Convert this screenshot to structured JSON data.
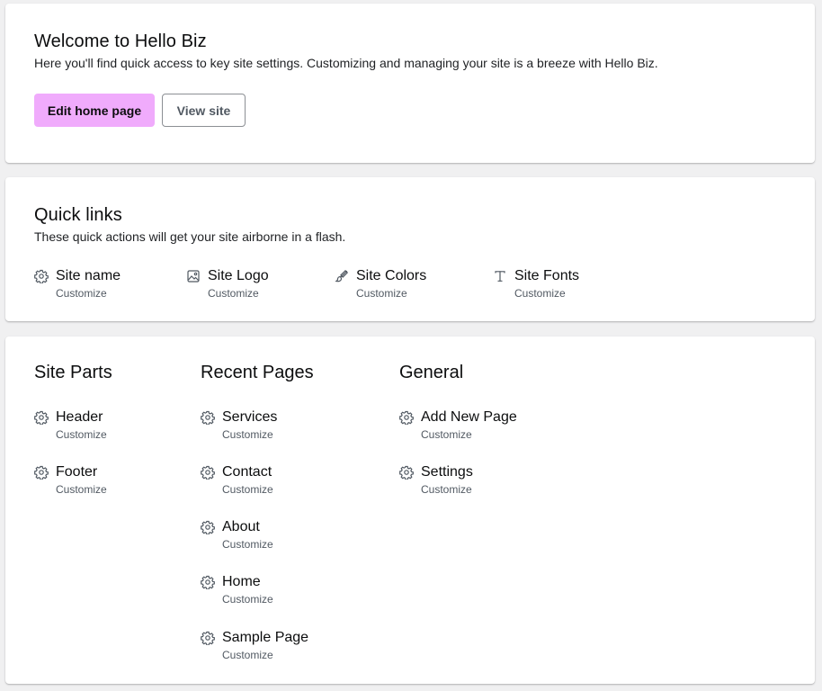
{
  "welcome": {
    "title": "Welcome to Hello Biz",
    "description": "Here you'll find quick access to key site settings. Customizing and managing your site is a breeze with Hello Biz.",
    "edit_button": "Edit home page",
    "view_button": "View site",
    "accent_color": "#f0abfc"
  },
  "quick_links": {
    "title": "Quick links",
    "description": "These quick actions will get your site airborne in a flash.",
    "items": [
      {
        "label": "Site name",
        "sub": "Customize",
        "icon": "gear-icon"
      },
      {
        "label": "Site Logo",
        "sub": "Customize",
        "icon": "image-icon"
      },
      {
        "label": "Site Colors",
        "sub": "Customize",
        "icon": "brush-icon"
      },
      {
        "label": "Site Fonts",
        "sub": "Customize",
        "icon": "typography-icon"
      }
    ]
  },
  "site_parts": {
    "title": "Site Parts",
    "items": [
      {
        "label": "Header",
        "sub": "Customize",
        "icon": "gear-icon"
      },
      {
        "label": "Footer",
        "sub": "Customize",
        "icon": "gear-icon"
      }
    ]
  },
  "recent_pages": {
    "title": "Recent Pages",
    "items": [
      {
        "label": "Services",
        "sub": "Customize",
        "icon": "gear-icon"
      },
      {
        "label": "Contact",
        "sub": "Customize",
        "icon": "gear-icon"
      },
      {
        "label": "About",
        "sub": "Customize",
        "icon": "gear-icon"
      },
      {
        "label": "Home",
        "sub": "Customize",
        "icon": "gear-icon"
      },
      {
        "label": "Sample Page",
        "sub": "Customize",
        "icon": "gear-icon"
      }
    ]
  },
  "general": {
    "title": "General",
    "items": [
      {
        "label": "Add New Page",
        "sub": "Customize",
        "icon": "gear-icon"
      },
      {
        "label": "Settings",
        "sub": "Customize",
        "icon": "gear-icon"
      }
    ]
  }
}
